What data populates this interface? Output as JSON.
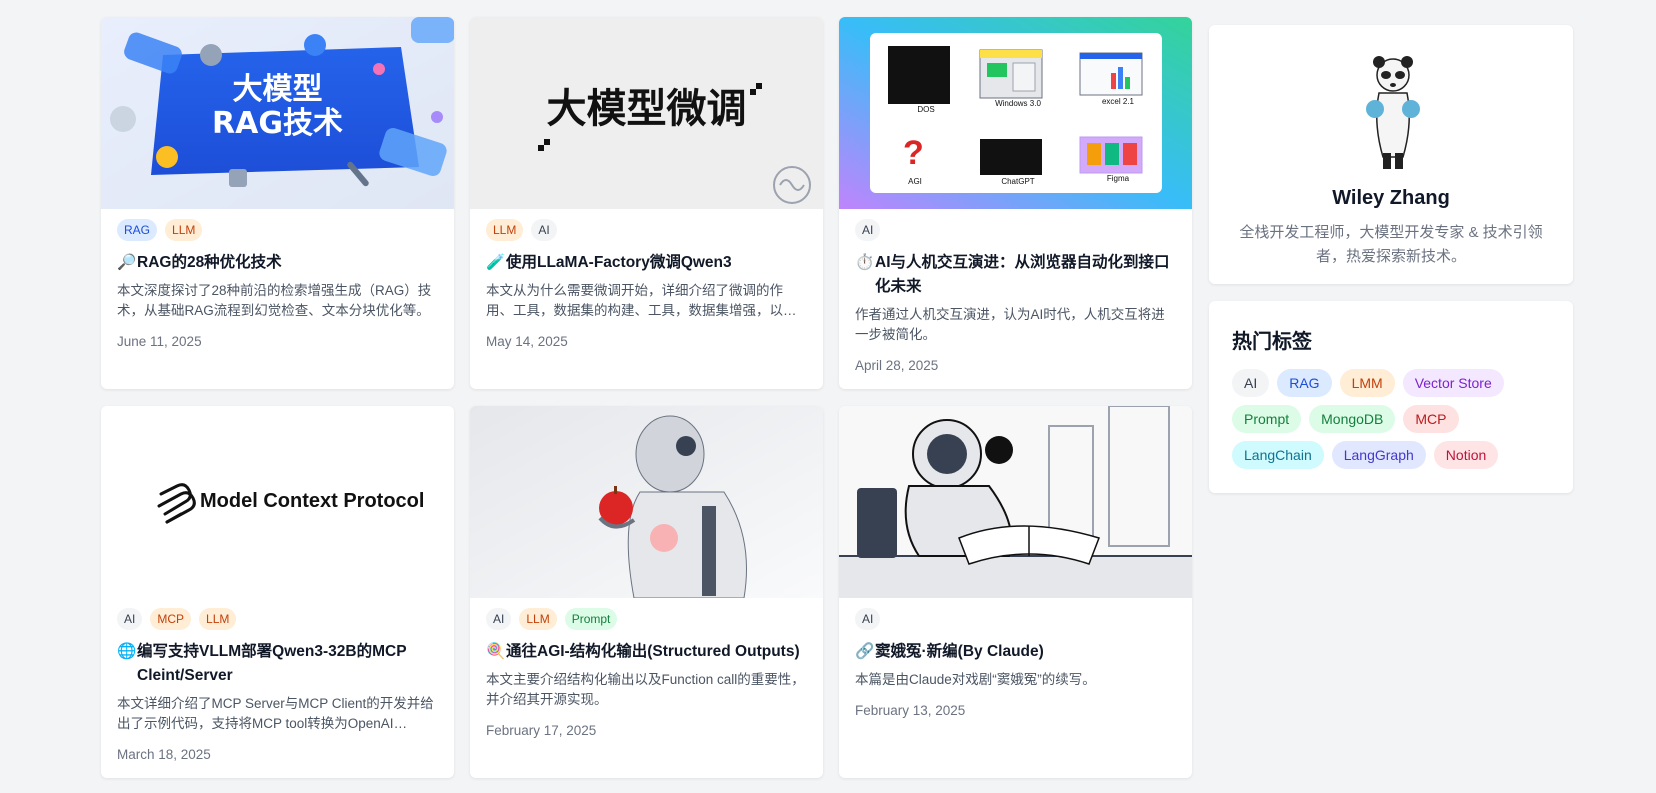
{
  "posts": [
    {
      "cover_text": [
        "大模型",
        "RAG技术"
      ],
      "tags": [
        {
          "label": "RAG",
          "color": "blue"
        },
        {
          "label": "LLM",
          "color": "orange"
        }
      ],
      "emoji": "🔎",
      "title": "RAG的28种优化技术",
      "excerpt": "本文深度探讨了28种前沿的检索增强生成（RAG）技术，从基础RAG流程到幻觉检查、文本分块优化等。",
      "date": "June 11, 2025"
    },
    {
      "cover_text": [
        "大模型微调"
      ],
      "tags": [
        {
          "label": "LLM",
          "color": "orange"
        },
        {
          "label": "AI",
          "color": "gray"
        }
      ],
      "emoji": "🧪",
      "title": "使用LLaMA-Factory微调Qwen3",
      "excerpt": "本文从为什么需要微调开始，详细介绍了微调的作用、工具，数据集的构建、工具，数据集增强，以及训练过程。",
      "date": "May 14, 2025"
    },
    {
      "cover_text": [
        "DOS",
        "Windows 3.0",
        "excel 2.1",
        "AGI",
        "ChatGPT",
        "Figma"
      ],
      "tags": [
        {
          "label": "AI",
          "color": "gray"
        }
      ],
      "emoji": "⏱️",
      "title": "AI与人机交互演进：从浏览器自动化到接口化未来",
      "excerpt": "作者通过人机交互演进，认为AI时代，人机交互将进一步被简化。",
      "date": "April 28, 2025"
    },
    {
      "cover_text": [
        "Model Context Protocol"
      ],
      "tags": [
        {
          "label": "AI",
          "color": "gray"
        },
        {
          "label": "MCP",
          "color": "orange"
        },
        {
          "label": "LLM",
          "color": "orange"
        }
      ],
      "emoji": "🌐",
      "title": "编写支持VLLM部署Qwen3-32B的MCP Cleint/Server",
      "excerpt": "本文详细介绍了MCP Server与MCP Client的开发并给出了示例代码，支持将MCP tool转换为OpenAI function call。",
      "date": "March 18, 2025"
    },
    {
      "cover_text": [],
      "tags": [
        {
          "label": "AI",
          "color": "gray"
        },
        {
          "label": "LLM",
          "color": "orange"
        },
        {
          "label": "Prompt",
          "color": "green"
        }
      ],
      "emoji": "🍭",
      "title": "通往AGI-结构化输出(Structured Outputs)",
      "excerpt": "本文主要介绍结构化输出以及Function call的重要性，并介绍其开源实现。",
      "date": "February 17, 2025"
    },
    {
      "cover_text": [],
      "tags": [
        {
          "label": "AI",
          "color": "gray"
        }
      ],
      "emoji": "🔗",
      "title": "窦娥冤·新编(By Claude)",
      "excerpt": "本篇是由Claude对戏剧“窦娥冤”的续写。",
      "date": "February 13, 2025"
    }
  ],
  "profile": {
    "name": "Wiley Zhang",
    "bio": "全栈开发工程师，大模型开发专家 & 技术引领者，热爱探索新技术。"
  },
  "hot_tags": {
    "title": "热门标签",
    "items": [
      {
        "label": "AI",
        "color": "gray"
      },
      {
        "label": "RAG",
        "color": "blue"
      },
      {
        "label": "LMM",
        "color": "orange"
      },
      {
        "label": "Vector Store",
        "color": "purple"
      },
      {
        "label": "Prompt",
        "color": "green"
      },
      {
        "label": "MongoDB",
        "color": "green"
      },
      {
        "label": "MCP",
        "color": "red"
      },
      {
        "label": "LangChain",
        "color": "cyan"
      },
      {
        "label": "LangGraph",
        "color": "indigo"
      },
      {
        "label": "Notion",
        "color": "rose"
      }
    ]
  }
}
